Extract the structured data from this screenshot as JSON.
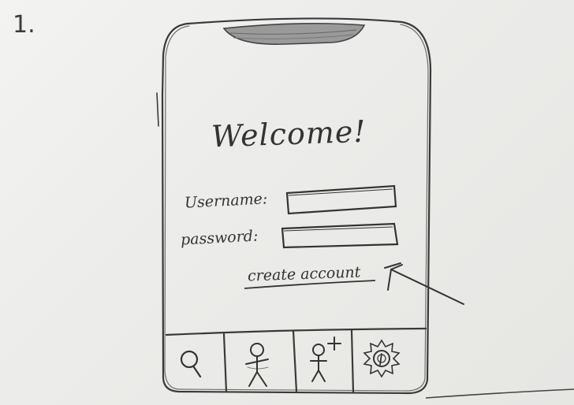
{
  "page_number": "1.",
  "screen": {
    "title": "Welcome!",
    "username_label": "Username:",
    "password_label": "password:",
    "create_account_label": "create account"
  },
  "bottom_nav": [
    {
      "icon": "search-icon",
      "name": "search"
    },
    {
      "icon": "person-icon",
      "name": "profile"
    },
    {
      "icon": "add-person-icon",
      "name": "add-friend"
    },
    {
      "icon": "gear-icon",
      "name": "settings"
    }
  ]
}
